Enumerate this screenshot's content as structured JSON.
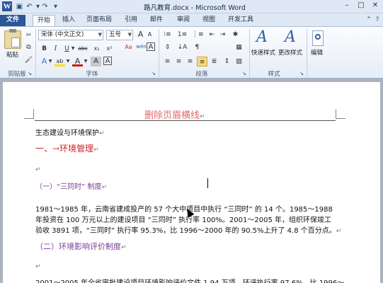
{
  "window": {
    "title": "路凡教育.docx - Microsoft Word",
    "app_logo": "W"
  },
  "tabs": [
    "文件",
    "开始",
    "插入",
    "页面布局",
    "引用",
    "邮件",
    "审阅",
    "视图",
    "开发工具"
  ],
  "ribbon": {
    "clipboard": {
      "paste_label": "粘贴",
      "group_label": "剪贴板"
    },
    "font": {
      "font_name": "宋体 (中文正文)",
      "font_size": "五号",
      "grow_glyph": "A",
      "shrink_glyph": "A",
      "clear_glyph": "Aa",
      "wen_glyph": "wén",
      "bold": "B",
      "italic": "I",
      "underline": "U",
      "strike": "abc",
      "subscript": "x₂",
      "superscript": "x²",
      "text_effect": "A",
      "highlight": "ab",
      "font_color": "A",
      "char_shade": "A",
      "char_border": "A",
      "group_label": "字体"
    },
    "paragraph": {
      "group_label": "段落"
    },
    "styles": {
      "quick_styles_label": "快速样式",
      "change_styles_label": "更改样式",
      "group_label": "样式"
    },
    "editing": {
      "label": "编辑"
    }
  },
  "document": {
    "header_text": "删除页眉横线",
    "lines": {
      "l1": "生态建设与环境保护",
      "l2_num": "一、→",
      "l2_text": "环境管理",
      "l4": "（一）“三同时” 制度",
      "l5": "1981～1985 年，云南省建成投产的 57 个大中项目中执行 “三同时” 的 14 个。1985～1988",
      "l6": "年投资在 100 万元以上的建设项目 “三同时” 执行率 100%。2001～2005 年，组织环保竣工",
      "l7": "验收 3891 项，“三同时” 执行率 95.3%，比 1996～2000 年的 90.5%上升了 4.8 个百分点。",
      "l8": "（二）环境影响评价制度",
      "l10": "2001～2005 年全省审批建设项目环境影响评价文件 1.94 万项，环评执行率 97.6%，比 1996～"
    },
    "para_mark": "↵"
  }
}
